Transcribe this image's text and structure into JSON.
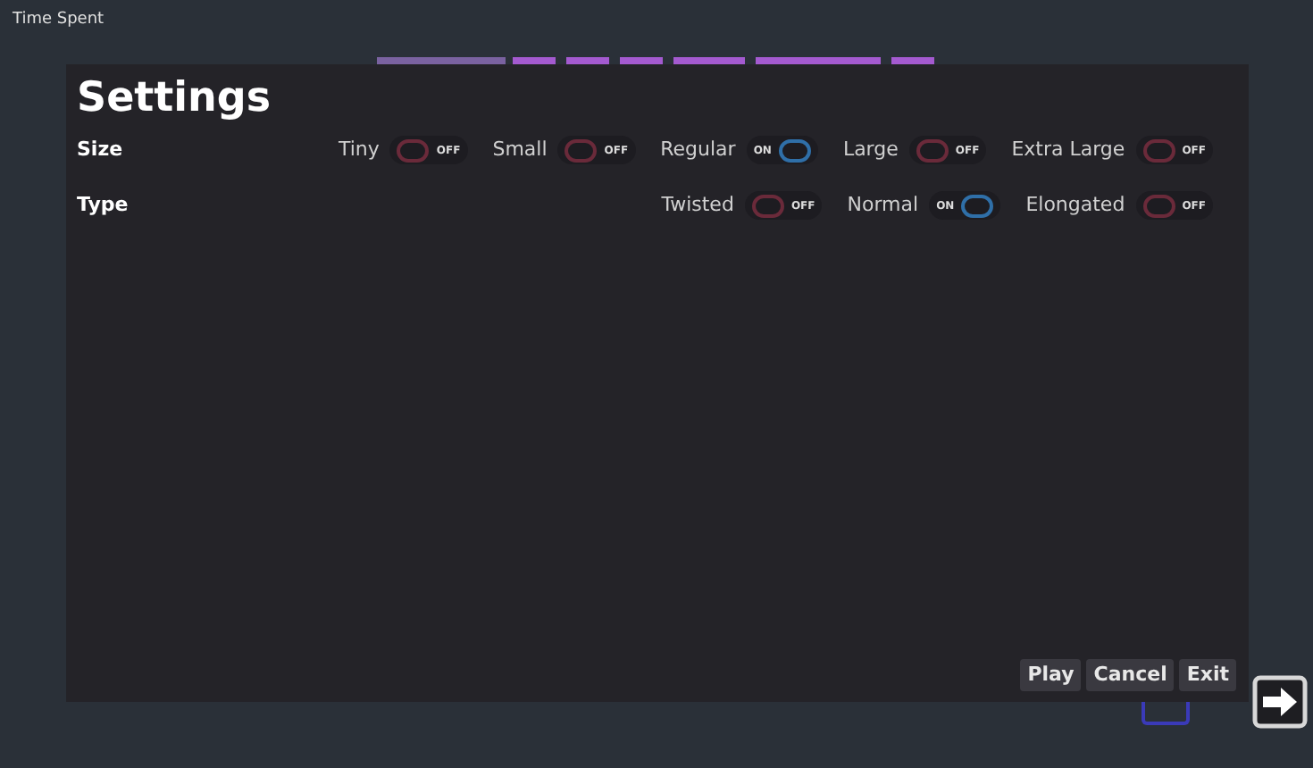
{
  "corner_label": "Time Spent",
  "title": "Settings",
  "groups": [
    {
      "label": "Size",
      "options": [
        {
          "label": "Tiny",
          "on": false,
          "state_text": "OFF"
        },
        {
          "label": "Small",
          "on": false,
          "state_text": "OFF"
        },
        {
          "label": "Regular",
          "on": true,
          "state_text": "ON"
        },
        {
          "label": "Large",
          "on": false,
          "state_text": "OFF"
        },
        {
          "label": "Extra Large",
          "on": false,
          "state_text": "OFF"
        }
      ]
    },
    {
      "label": "Type",
      "options": [
        {
          "label": "Twisted",
          "on": false,
          "state_text": "OFF"
        },
        {
          "label": "Normal",
          "on": true,
          "state_text": "ON"
        },
        {
          "label": "Elongated",
          "on": false,
          "state_text": "OFF"
        }
      ]
    }
  ],
  "buttons": [
    "Play",
    "Cancel",
    "Exit"
  ]
}
